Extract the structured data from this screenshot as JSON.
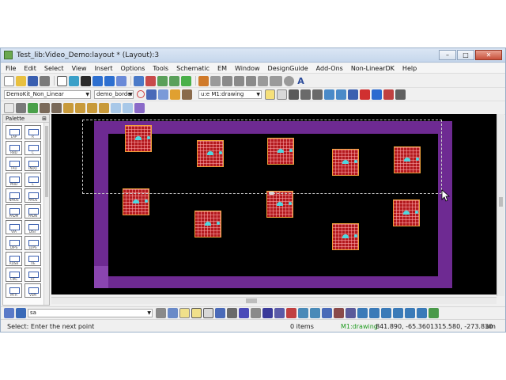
{
  "window": {
    "title": "Test_lib:Video_Demo:layout * (Layout):3",
    "buttons": [
      "–",
      "□",
      "✕"
    ]
  },
  "menu": [
    "File",
    "Edit",
    "Select",
    "View",
    "Insert",
    "Options",
    "Tools",
    "Schematic",
    "EM",
    "Window",
    "DesignGuide",
    "Add-Ons",
    "Non-LinearDK",
    "Help"
  ],
  "toolbar2": {
    "library_combo": "DemoKit_Non_Linear",
    "cell_combo": "demo_border",
    "layer_combo": "u:e M1:drawing"
  },
  "palette": {
    "title": "Palette",
    "items": [
      "LAP",
      "R",
      "RBD",
      "C",
      "TAU",
      "INDQ",
      "PKID",
      "L",
      "NMOS",
      "PMOS",
      "PADM",
      "PADN",
      "VIA",
      "DIST",
      "DIPS",
      "LUPS",
      "RDSB",
      "TIE",
      "CIRC",
      "VT",
      "MTR",
      "VSM"
    ]
  },
  "bottom_toolbar": {
    "snap_combo": "sa"
  },
  "status": {
    "prompt": "Select: Enter the next point",
    "items": "0 items",
    "layer": "M1:drawing",
    "coord1": "841.890, -65.360",
    "coord2": "1315.580, -273.830",
    "unit": "um"
  },
  "colors": {
    "canvas": "#000000",
    "border_layer": "#6e2a92",
    "pad_fill": "#b3191e",
    "pad_outline": "#f2a23a",
    "pin": "#4fd7df",
    "status_layer": "#1e9b1e"
  },
  "toolbar_icons": {
    "row1": [
      "new-icon",
      "open-icon",
      "save-icon",
      "print-icon",
      "select-icon",
      "move-icon",
      "delete-icon",
      "undo-icon",
      "redo-icon",
      "rotate-icon",
      "zoom-fit-icon",
      "zoom-area-icon",
      "zoom-in-icon",
      "zoom-out-icon",
      "pan-icon",
      "import-icon",
      "export-icon",
      "polyline-icon",
      "path-icon",
      "arc-icon",
      "polygon-icon",
      "rectangle-icon",
      "circle-icon",
      "text-icon"
    ],
    "row3": [
      "select-mode-icon",
      "resize-icon",
      "snap-icon",
      "rotate-left-icon",
      "rotate-right-icon",
      "flip-icon",
      "mirror-icon",
      "grid-icon",
      "align-icon",
      "measure-icon",
      "ruler-icon",
      "component-icon"
    ]
  }
}
